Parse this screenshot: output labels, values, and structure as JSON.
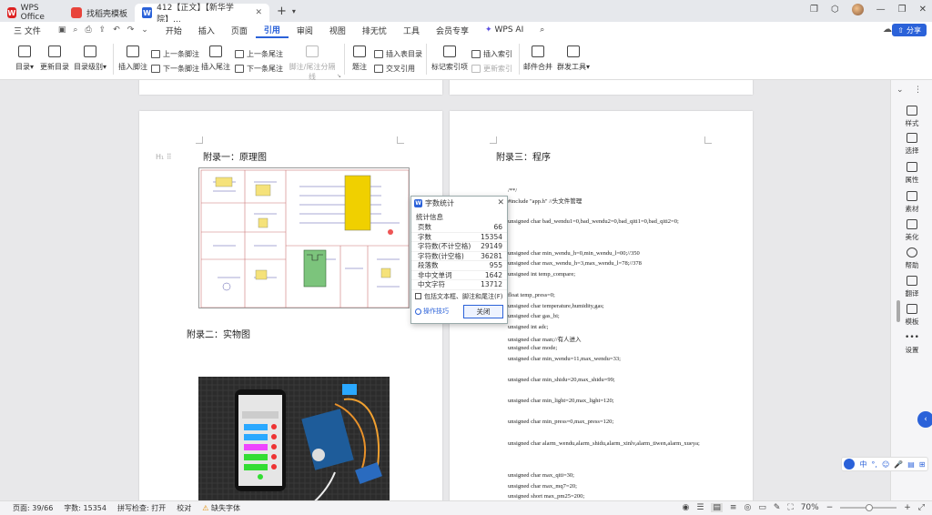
{
  "tabs": {
    "home": "WPS Office",
    "template": "找稻壳模板",
    "doc": "412【正文】【新华学院】..."
  },
  "menu": {
    "file": "三 文件",
    "items": [
      "开始",
      "插入",
      "页面",
      "引用",
      "审阅",
      "视图",
      "排无忧",
      "工具",
      "会员专享"
    ],
    "active": "引用",
    "wps_ai": "WPS AI",
    "share": "分享"
  },
  "ribbon": {
    "toc": "目录",
    "update_toc": "更新目录",
    "toc_level": "目录级别",
    "insert_footnote": "插入脚注",
    "prev_footnote": "上一条脚注",
    "next_footnote": "下一条脚注",
    "insert_endnote": "插入尾注",
    "prev_endnote": "上一条尾注",
    "next_endnote": "下一条尾注",
    "footnote_sep": "脚注/尾注分隔线",
    "caption": "题注",
    "insert_table_toc": "插入表目录",
    "cross_ref": "交叉引用",
    "mark_index": "标记索引项",
    "insert_index": "插入索引",
    "update_index": "更新索引",
    "mail_merge": "邮件合并",
    "bulk_tools": "群发工具"
  },
  "doc": {
    "appendix1": "附录一：原理图",
    "appendix2": "附录二：实物图",
    "appendix3": "附录三：程序",
    "code": [
      "/**/",
      "#include \"app.h\"              //头文件管理",
      "unsigned char bad_wendu1=0,bad_wendu2=0,bad_qiti1=0,bad_qiti2=0;",
      "unsigned char min_wendu_h=0,min_wendu_l=00;//350",
      "unsigned char max_wendu_h=3,max_wendu_l=78;//378",
      "unsigned int temp_compare;",
      "float temp_press=0;",
      "unsigned char temperature,humidity,gas;",
      "unsigned char gas_bi;",
      "unsigned int    adc;",
      "unsigned char man;//有人进入",
      "unsigned char mode;",
      "unsigned char min_wendu=11,max_wendu=33;",
      "unsigned char min_shidu=20,max_shidu=99;",
      "unsigned char min_light=20,max_light=120;",
      "unsigned char min_press=0,max_press=120;",
      "unsigned char alarm_wendu,alarm_shidu,alarm_xinlv,alarm_tiwen,alarm_xueya;",
      "unsigned char max_qiti=30;",
      "unsigned char max_mq7=20;",
      "unsigned short max_pm25=200;"
    ]
  },
  "dialog": {
    "title": "字数统计",
    "section": "统计信息",
    "rows": [
      {
        "label": "页数",
        "value": "66"
      },
      {
        "label": "字数",
        "value": "15354"
      },
      {
        "label": "字符数(不计空格)",
        "value": "29149"
      },
      {
        "label": "字符数(计空格)",
        "value": "36281"
      },
      {
        "label": "段落数",
        "value": "955"
      },
      {
        "label": "非中文单词",
        "value": "1642"
      },
      {
        "label": "中文字符",
        "value": "13712"
      }
    ],
    "checkbox": "包括文本框、脚注和尾注(F)",
    "tips": "操作技巧",
    "close": "关闭"
  },
  "sidebar": [
    "样式",
    "选择",
    "属性",
    "素材",
    "美化",
    "帮助",
    "翻译",
    "模板",
    "设置"
  ],
  "status": {
    "page": "页面: 39/66",
    "words": "字数: 15354",
    "spell": "拼写检查: 打开",
    "proof": "校对",
    "missing_font": "缺失字体",
    "zoom": "70%"
  },
  "ime": [
    "中",
    "°,",
    "☺"
  ]
}
